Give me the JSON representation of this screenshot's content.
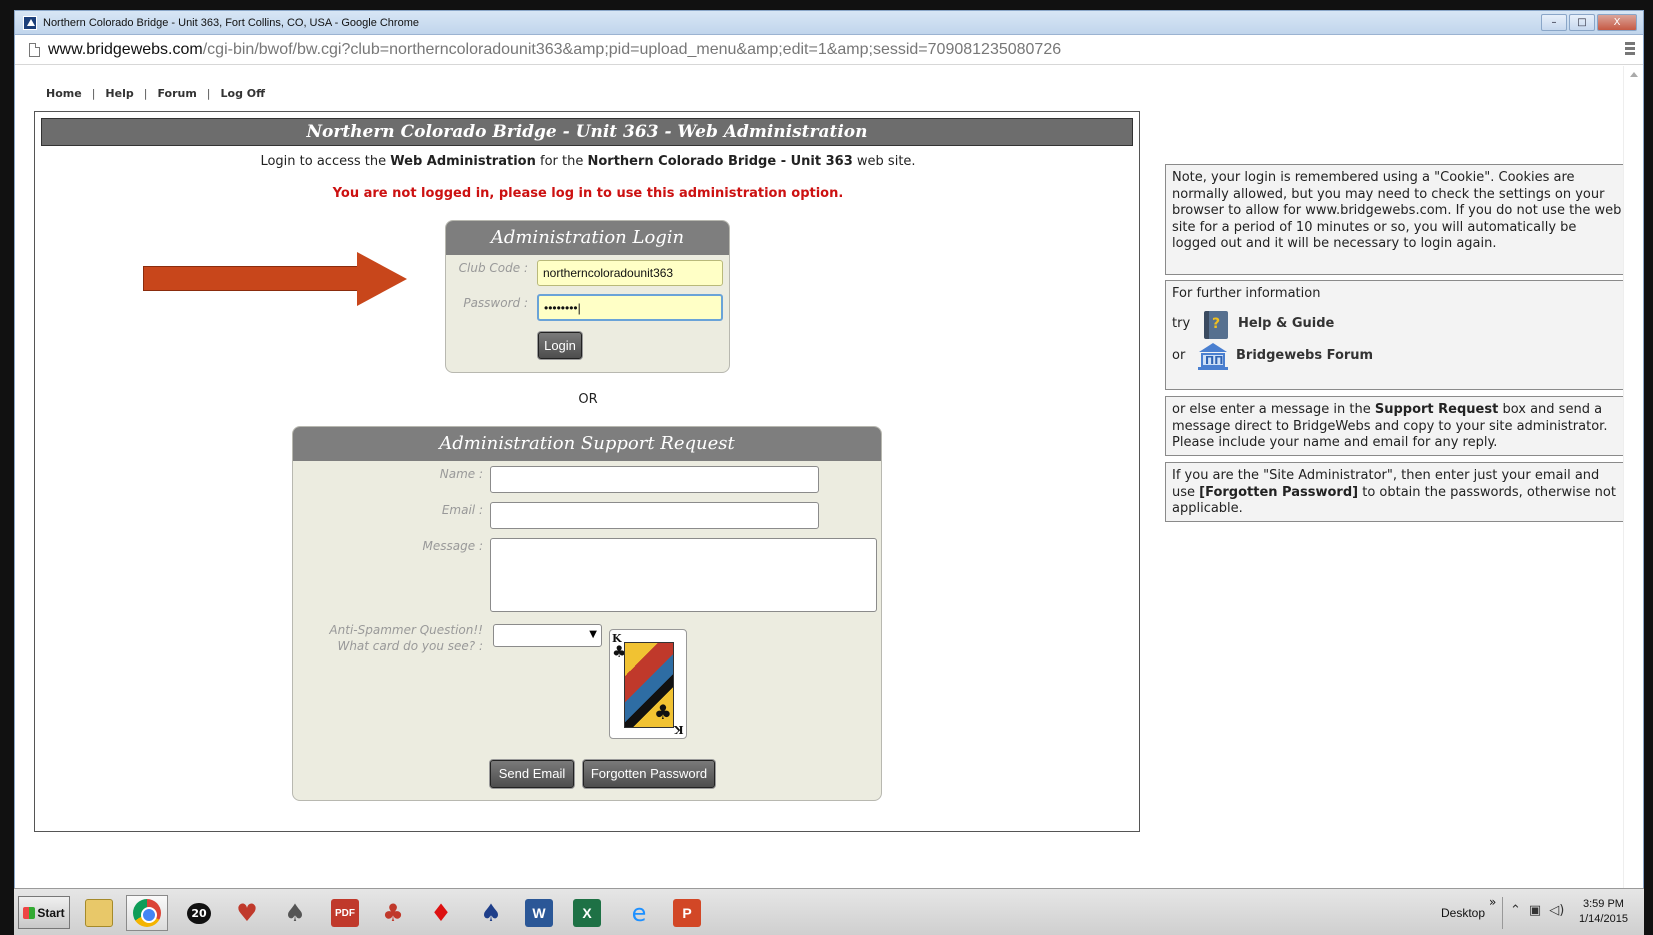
{
  "window": {
    "title": "Northern Colorado Bridge - Unit 363, Fort Collins, CO, USA - Google Chrome",
    "controls": {
      "minimize": "–",
      "maximize": "□",
      "close": "X"
    }
  },
  "address_bar": {
    "domain": "www.bridgewebs.com",
    "path": "/cgi-bin/bwof/bw.cgi?club=northerncoloradounit363&amp;pid=upload_menu&amp;edit=1&amp;sessid=709081235080726"
  },
  "topnav": {
    "items": [
      "Home",
      "Help",
      "Forum",
      "Log Off"
    ],
    "separator": "|"
  },
  "main": {
    "header": "Northern Colorado Bridge - Unit 363 - Web Administration",
    "intro": {
      "prefix": "Login to access the ",
      "bold1": "Web Administration",
      "middle": " for the ",
      "bold2": "Northern Colorado Bridge - Unit 363",
      "suffix": " web site."
    },
    "warning": "You are not logged in, please log in to use this administration option."
  },
  "login": {
    "title": "Administration Login",
    "club_code_label": "Club Code :",
    "club_code_value": "northerncoloradounit363",
    "password_label": "Password :",
    "password_value": "••••••••|",
    "login_button": "Login"
  },
  "or_text": "OR",
  "support": {
    "title": "Administration Support Request",
    "name_label": "Name :",
    "email_label": "Email :",
    "message_label": "Message :",
    "antispam_label_1": "Anti-Spammer Question!!",
    "antispam_label_2": "What card do you see? :",
    "select_arrow": "▼",
    "card_rank": "K",
    "card_suit": "♣",
    "send_button": "Send Email",
    "forgotten_button": "Forgotten Password"
  },
  "info": {
    "cookie_note": "Note, your login is remembered using a \"Cookie\". Cookies are normally allowed, but you may need to check the settings on your browser to allow for www.bridgewebs.com. If you do not use the web site for a period of 10 minutes or so, you will automatically be logged out and it will be necessary to login again.",
    "further_info": "For further information",
    "try_label": "try",
    "help_link": "Help & Guide",
    "or_label": "or",
    "forum_link": "Bridgewebs Forum",
    "support_prefix": "or else enter a message in the ",
    "support_bold": "Support Request",
    "support_suffix": " box and send a message direct to BridgeWebs and copy to your site administrator. Please include your name and email for any reply.",
    "admin_prefix": "If you are the \"Site Administrator\", then enter just your email and use ",
    "admin_bold": "[Forgotten Password]",
    "admin_suffix": " to obtain the passwords, otherwise not applicable."
  },
  "taskbar": {
    "start": "Start",
    "desktop": "Desktop",
    "chevron": "»",
    "time": "3:59 PM",
    "date": "1/14/2015",
    "spade_badge": "20",
    "pdf_label": "PDF",
    "word_label": "W",
    "excel_label": "X",
    "ppt_label": "P"
  },
  "colors": {
    "header_gray": "#6d6d6d",
    "panel_bg": "#ecece0",
    "warning_red": "#cc1111",
    "arrow_orange": "#c8461b",
    "input_yellow": "#ffffc6"
  }
}
